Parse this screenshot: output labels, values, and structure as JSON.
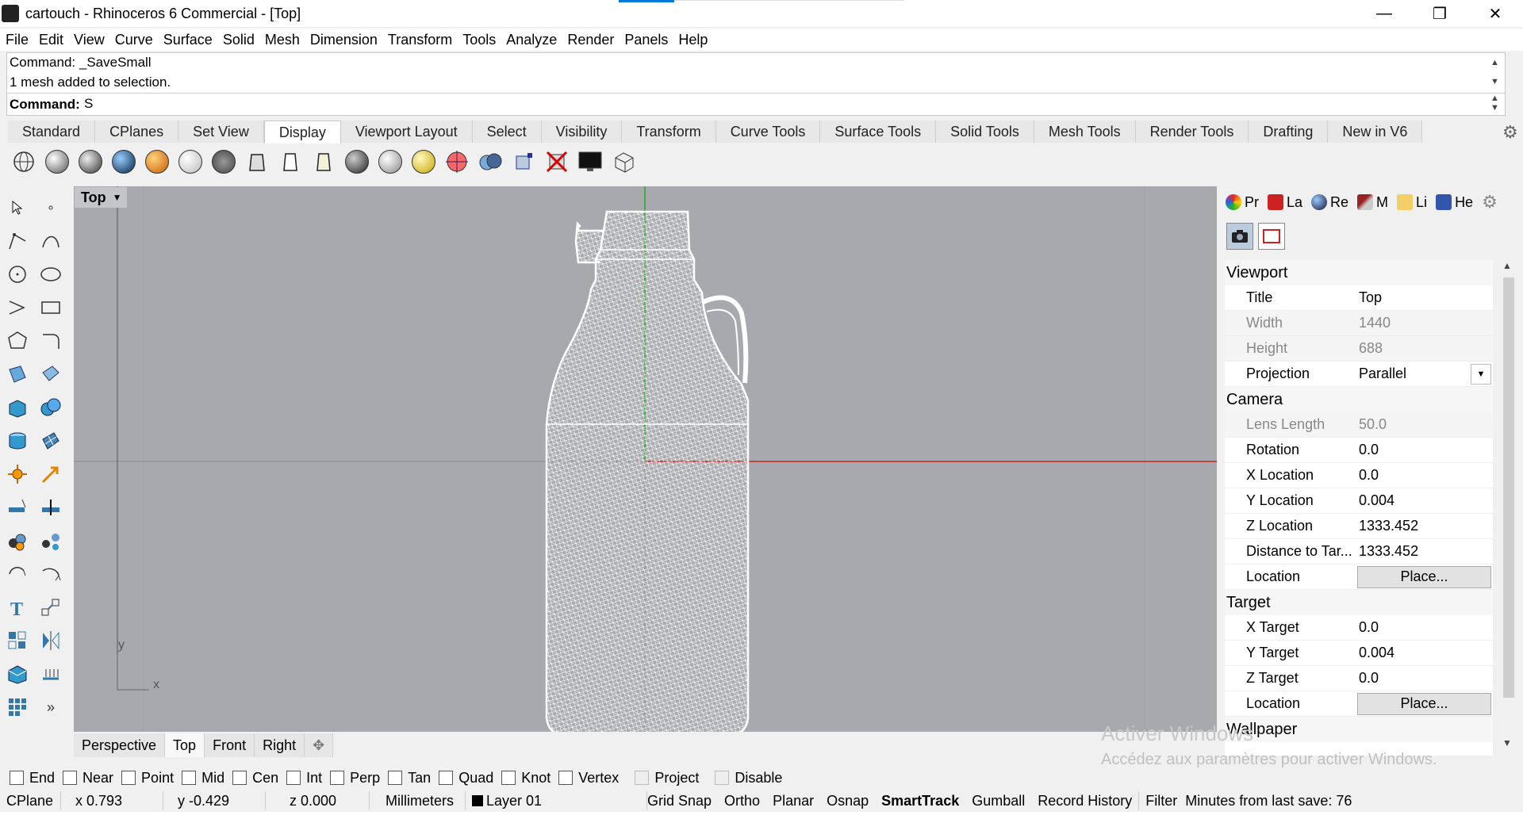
{
  "window": {
    "title": "cartouch - Rhinoceros 6 Commercial - [Top]",
    "minimize": "—",
    "restore": "❐",
    "close": "✕"
  },
  "menu": [
    "File",
    "Edit",
    "View",
    "Curve",
    "Surface",
    "Solid",
    "Mesh",
    "Dimension",
    "Transform",
    "Tools",
    "Analyze",
    "Render",
    "Panels",
    "Help"
  ],
  "command": {
    "history": [
      "Command: _SaveSmall",
      "1 mesh added to selection."
    ],
    "prompt_label": "Command:",
    "input_value": "S"
  },
  "toolbar_tabs": [
    "Standard",
    "CPlanes",
    "Set View",
    "Display",
    "Viewport Layout",
    "Select",
    "Visibility",
    "Transform",
    "Curve Tools",
    "Surface Tools",
    "Solid Tools",
    "Mesh Tools",
    "Render Tools",
    "Drafting",
    "New in V6"
  ],
  "active_toolbar_tab": "Display",
  "display_icons": [
    "wireframe-sphere-icon",
    "shaded-sphere-icon",
    "rendered-sphere-icon",
    "blue-sphere-icon",
    "gold-sphere-icon",
    "ghosted-sphere-icon",
    "xray-sphere-icon",
    "technical-icon",
    "artistic-icon",
    "pen-icon",
    "wireframe-globe-icon",
    "shaded-ball-icon",
    "yellow-ball-icon",
    "target-ball-icon",
    "twin-spheres-icon",
    "box-grips-icon",
    "disable-icon",
    "monitor-icon",
    "shaded-box-icon"
  ],
  "viewport": {
    "label": "Top",
    "axis_y": "y",
    "axis_x": "x",
    "tabs": [
      "Perspective",
      "Top",
      "Front",
      "Right"
    ],
    "active_tab": "Top",
    "add_tab_icon": "✥"
  },
  "panel": {
    "tabs": [
      {
        "label": "Pr",
        "icon": "properties-icon",
        "color": "#d33"
      },
      {
        "label": "La",
        "icon": "layers-icon",
        "color": "#c22"
      },
      {
        "label": "Re",
        "icon": "render-icon",
        "color": "#226"
      },
      {
        "label": "M",
        "icon": "materials-icon",
        "color": "#922"
      },
      {
        "label": "Li",
        "icon": "libraries-icon",
        "color": "#d9a"
      },
      {
        "label": "He",
        "icon": "help-icon",
        "color": "#35a"
      }
    ],
    "sections": [
      {
        "title": "Viewport",
        "rows": [
          {
            "key": "Title",
            "value": "Top",
            "dim": false
          },
          {
            "key": "Width",
            "value": "1440",
            "dim": true
          },
          {
            "key": "Height",
            "value": "688",
            "dim": true
          },
          {
            "key": "Projection",
            "value": "Parallel",
            "dim": false,
            "dropdown": true
          }
        ]
      },
      {
        "title": "Camera",
        "rows": [
          {
            "key": "Lens Length",
            "value": "50.0",
            "dim": true
          },
          {
            "key": "Rotation",
            "value": "0.0",
            "dim": false
          },
          {
            "key": "X Location",
            "value": "0.0",
            "dim": false
          },
          {
            "key": "Y Location",
            "value": "0.004",
            "dim": false
          },
          {
            "key": "Z Location",
            "value": "1333.452",
            "dim": false
          },
          {
            "key": "Distance to Tar...",
            "value": "1333.452",
            "dim": false
          },
          {
            "key": "Location",
            "value": "Place...",
            "button": true
          }
        ]
      },
      {
        "title": "Target",
        "rows": [
          {
            "key": "X Target",
            "value": "0.0",
            "dim": false
          },
          {
            "key": "Y Target",
            "value": "0.004",
            "dim": false
          },
          {
            "key": "Z Target",
            "value": "0.0",
            "dim": false
          },
          {
            "key": "Location",
            "value": "Place...",
            "button": true
          }
        ]
      },
      {
        "title": "Wallpaper",
        "rows": []
      }
    ]
  },
  "watermark": {
    "line1": "Activer Windows",
    "line2": "Accédez aux paramètres pour activer Windows."
  },
  "osnaps": [
    {
      "label": "End",
      "checked": false,
      "dim": false
    },
    {
      "label": "Near",
      "checked": false,
      "dim": false
    },
    {
      "label": "Point",
      "checked": false,
      "dim": false
    },
    {
      "label": "Mid",
      "checked": false,
      "dim": false
    },
    {
      "label": "Cen",
      "checked": false,
      "dim": false
    },
    {
      "label": "Int",
      "checked": false,
      "dim": false
    },
    {
      "label": "Perp",
      "checked": false,
      "dim": false
    },
    {
      "label": "Tan",
      "checked": false,
      "dim": false
    },
    {
      "label": "Quad",
      "checked": false,
      "dim": false
    },
    {
      "label": "Knot",
      "checked": false,
      "dim": false
    },
    {
      "label": "Vertex",
      "checked": false,
      "dim": false
    },
    {
      "label": "Project",
      "checked": false,
      "dim": true
    },
    {
      "label": "Disable",
      "checked": false,
      "dim": true
    }
  ],
  "status": {
    "cplane": "CPlane",
    "x": "x 0.793",
    "y": "y -0.429",
    "z": "z 0.000",
    "units": "Millimeters",
    "layer": "Layer 01",
    "layer_color": "#000000",
    "toggles": [
      {
        "label": "Grid Snap",
        "bold": false
      },
      {
        "label": "Ortho",
        "bold": false
      },
      {
        "label": "Planar",
        "bold": false
      },
      {
        "label": "Osnap",
        "bold": false
      },
      {
        "label": "SmartTrack",
        "bold": true
      },
      {
        "label": "Gumball",
        "bold": false
      },
      {
        "label": "Record History",
        "bold": false
      },
      {
        "label": "Filter",
        "bold": false
      }
    ],
    "autosave": "Minutes from last save: 76"
  }
}
